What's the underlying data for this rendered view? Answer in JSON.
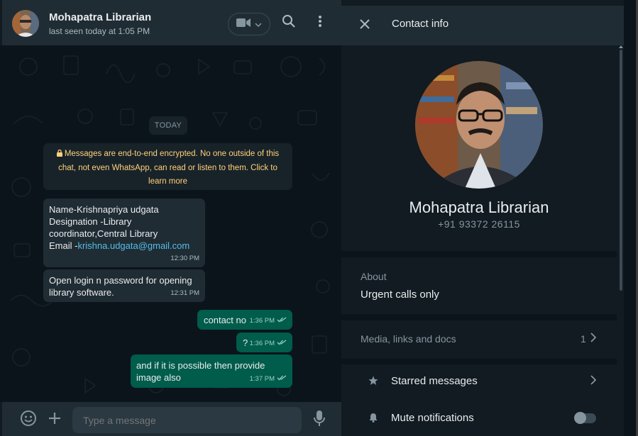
{
  "chat": {
    "contact_name": "Mohapatra Librarian",
    "last_seen": "last seen today at 1:05 PM",
    "day_chip": "TODAY",
    "encryption_notice": "Messages are end-to-end encrypted. No one outside of this chat, not even WhatsApp, can read or listen to them. Click to learn more",
    "messages": [
      {
        "direction": "in",
        "lines": [
          "Name-Krishnapriya udgata",
          "Designation -Library",
          "coordinator,Central Library"
        ],
        "email_prefix": "Email -",
        "email": "krishna.udgata@gmail.com",
        "time": "12:30 PM"
      },
      {
        "direction": "in",
        "lines": [
          "Open  login n password for opening",
          "library software."
        ],
        "time": "12:31 PM"
      },
      {
        "direction": "out",
        "text": "contact no",
        "time": "1:36 PM",
        "status": "read"
      },
      {
        "direction": "out",
        "text": "?",
        "time": "1:36 PM",
        "status": "read"
      },
      {
        "direction": "out",
        "lines": [
          "and if it is possible then provide",
          "image also"
        ],
        "time": "1:37 PM",
        "status": "read"
      }
    ],
    "composer": {
      "placeholder": "Type a message"
    }
  },
  "contact_info": {
    "title": "Contact info",
    "name": "Mohapatra Librarian",
    "phone": "+91 93372 26115",
    "about_label": "About",
    "about_text": "Urgent calls only",
    "media_label": "Media, links and docs",
    "media_count": "1",
    "starred_label": "Starred messages",
    "mute_label": "Mute notifications",
    "mute_enabled": false
  },
  "icons": [
    "video-call-icon",
    "search-icon",
    "menu-icon",
    "lock-icon",
    "double-check-icon",
    "emoji-icon",
    "attach-icon",
    "mic-icon",
    "close-icon",
    "chevron-right-icon",
    "star-icon",
    "bell-icon"
  ],
  "colors": {
    "app_bg": "#0b141a",
    "panel": "#202c33",
    "outgoing_bubble": "#005c4b",
    "incoming_bubble": "#202c33",
    "link": "#53bdeb",
    "notice_text": "#ffd279"
  }
}
